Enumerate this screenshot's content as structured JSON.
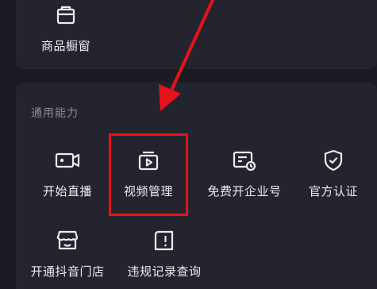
{
  "top_card": {
    "item": {
      "label": "商品橱窗",
      "icon": "storefront-bag-icon"
    }
  },
  "general_section": {
    "title": "通用能力",
    "items": [
      {
        "label": "开始直播",
        "icon": "live-camera-icon"
      },
      {
        "label": "视频管理",
        "icon": "video-folder-icon"
      },
      {
        "label": "免费开企业号",
        "icon": "enterprise-card-icon"
      },
      {
        "label": "官方认证",
        "icon": "shield-check-icon"
      },
      {
        "label": "开通抖音门店",
        "icon": "shop-awning-icon"
      },
      {
        "label": "违规记录查询",
        "icon": "violation-record-icon"
      }
    ]
  },
  "annotation": {
    "highlight_color": "#e8121a",
    "arrow_color": "#e8121a"
  }
}
